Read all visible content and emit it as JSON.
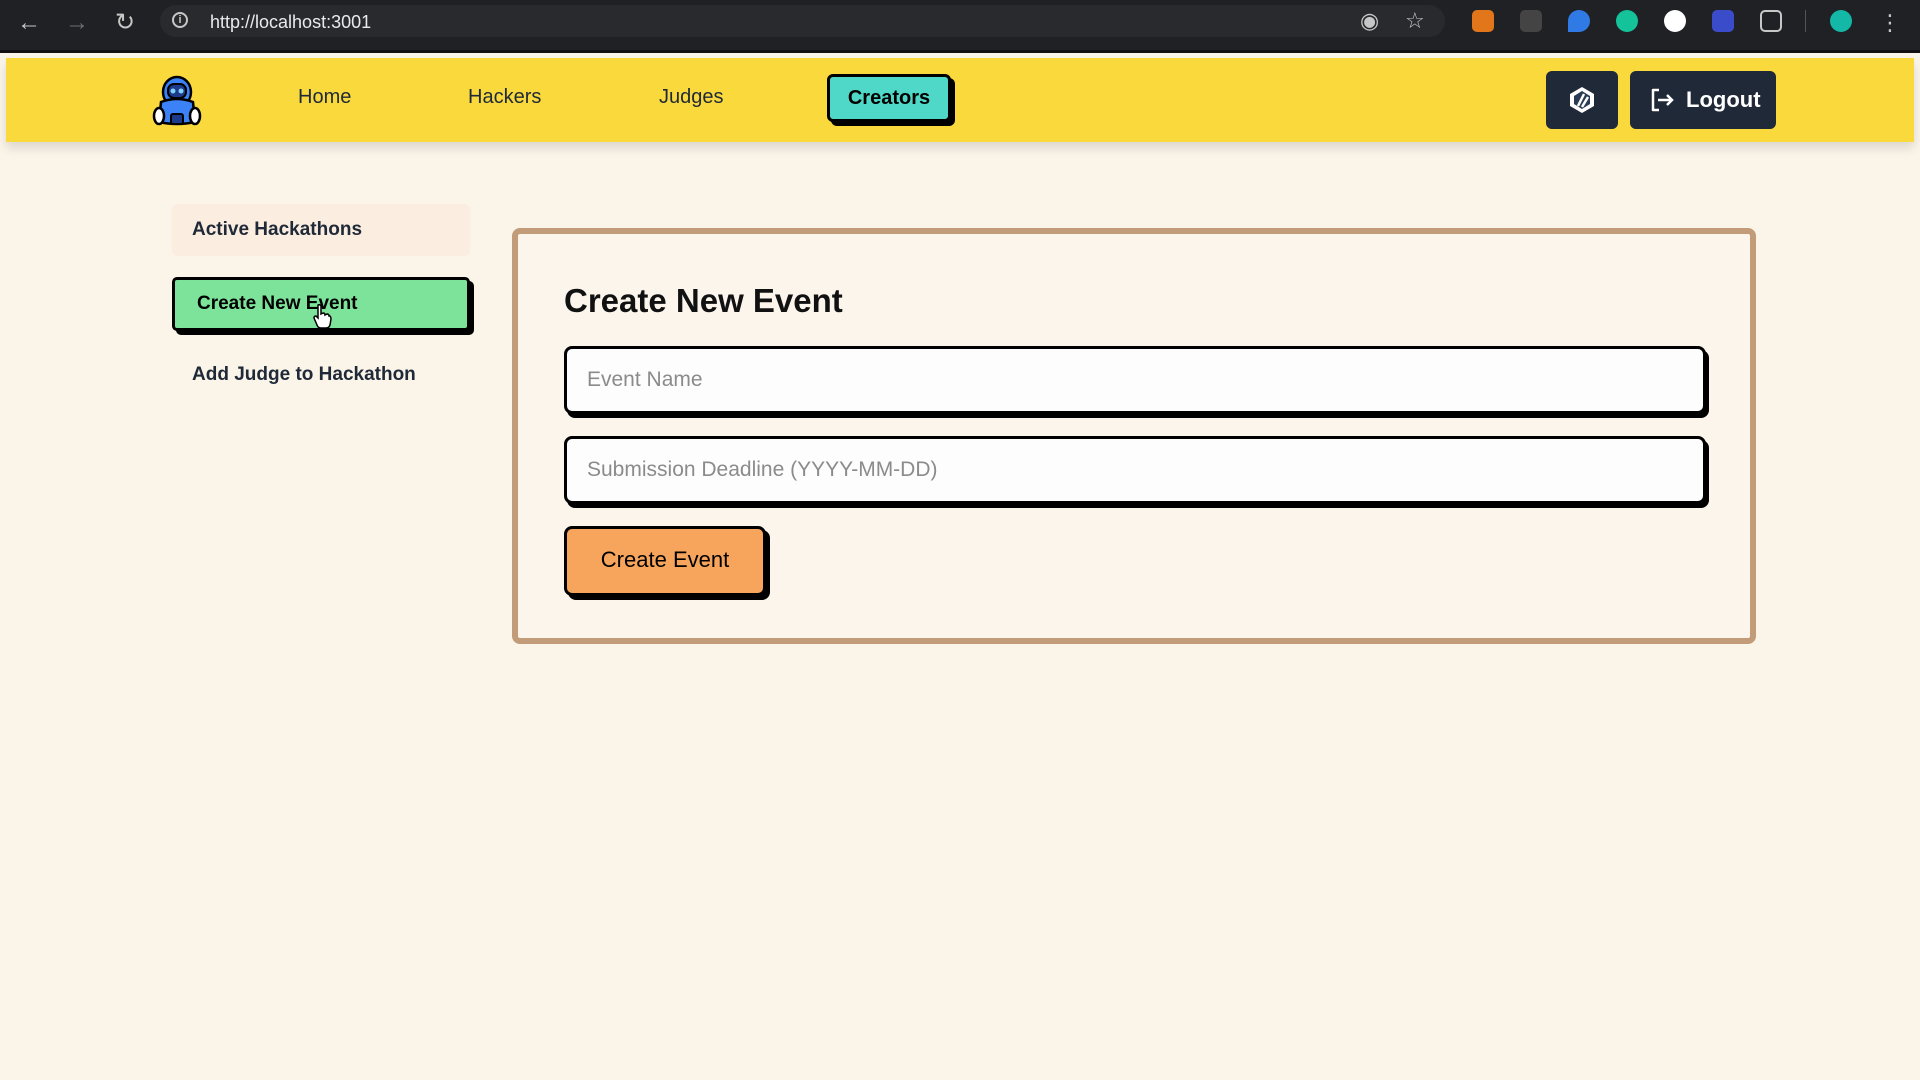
{
  "browser": {
    "url": "http://localhost:3001"
  },
  "header": {
    "nav": [
      {
        "label": "Home"
      },
      {
        "label": "Hackers"
      },
      {
        "label": "Judges"
      },
      {
        "label": "Creators"
      }
    ],
    "logout_label": "Logout"
  },
  "sidebar": {
    "items": [
      {
        "label": "Active Hackathons"
      },
      {
        "label": "Create New Event"
      },
      {
        "label": "Add Judge to Hackathon"
      }
    ]
  },
  "main": {
    "title": "Create New Event",
    "event_name": {
      "value": "",
      "placeholder": "Event Name"
    },
    "deadline": {
      "value": "",
      "placeholder": "Submission Deadline (YYYY-MM-DD)"
    },
    "submit_label": "Create Event"
  },
  "colors": {
    "header_bg": "#fad93c",
    "nav_active": "#4fd8c7",
    "sidebar_active": "#7ee39a",
    "submit": "#f7a55c",
    "card_border": "#c29b78",
    "page_bg": "#faf4e9"
  }
}
